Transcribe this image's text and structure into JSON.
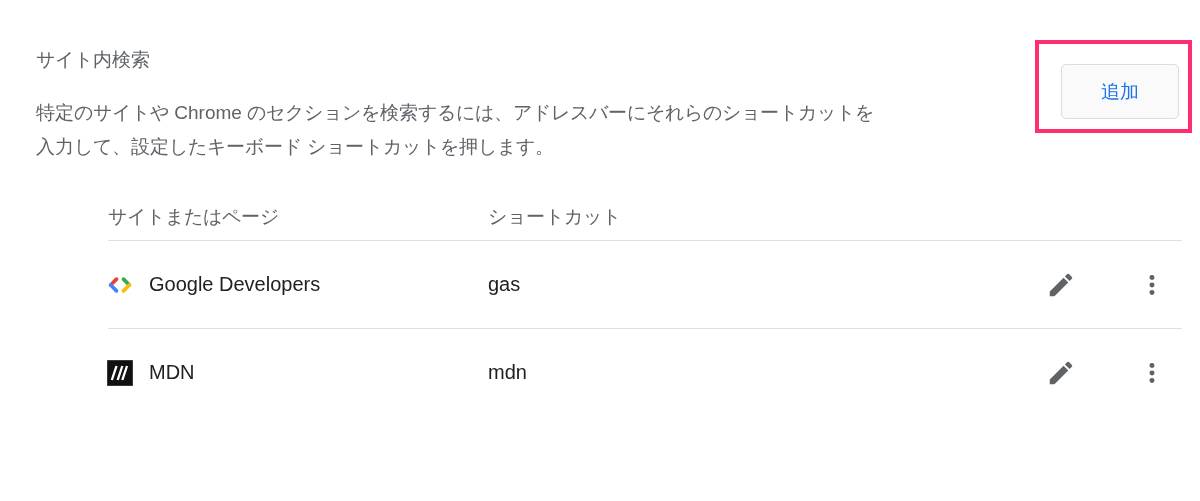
{
  "section": {
    "title": "サイト内検索",
    "description_lines": [
      "特定のサイトや Chrome のセクションを検索するには、アドレスバーにそれらのショートカットを",
      "入力して、設定したキーボード ショートカットを押します。"
    ]
  },
  "add_button": {
    "label": "追加",
    "highlighted": true
  },
  "table": {
    "columns": [
      "サイトまたはページ",
      "ショートカット"
    ],
    "rows": [
      {
        "icon": {
          "kind": "code-brackets"
        },
        "site": "Google Developers",
        "shortcut": "gas"
      },
      {
        "icon": {
          "kind": "letter-tile"
        },
        "site": "MDN",
        "shortcut": "mdn"
      }
    ]
  }
}
